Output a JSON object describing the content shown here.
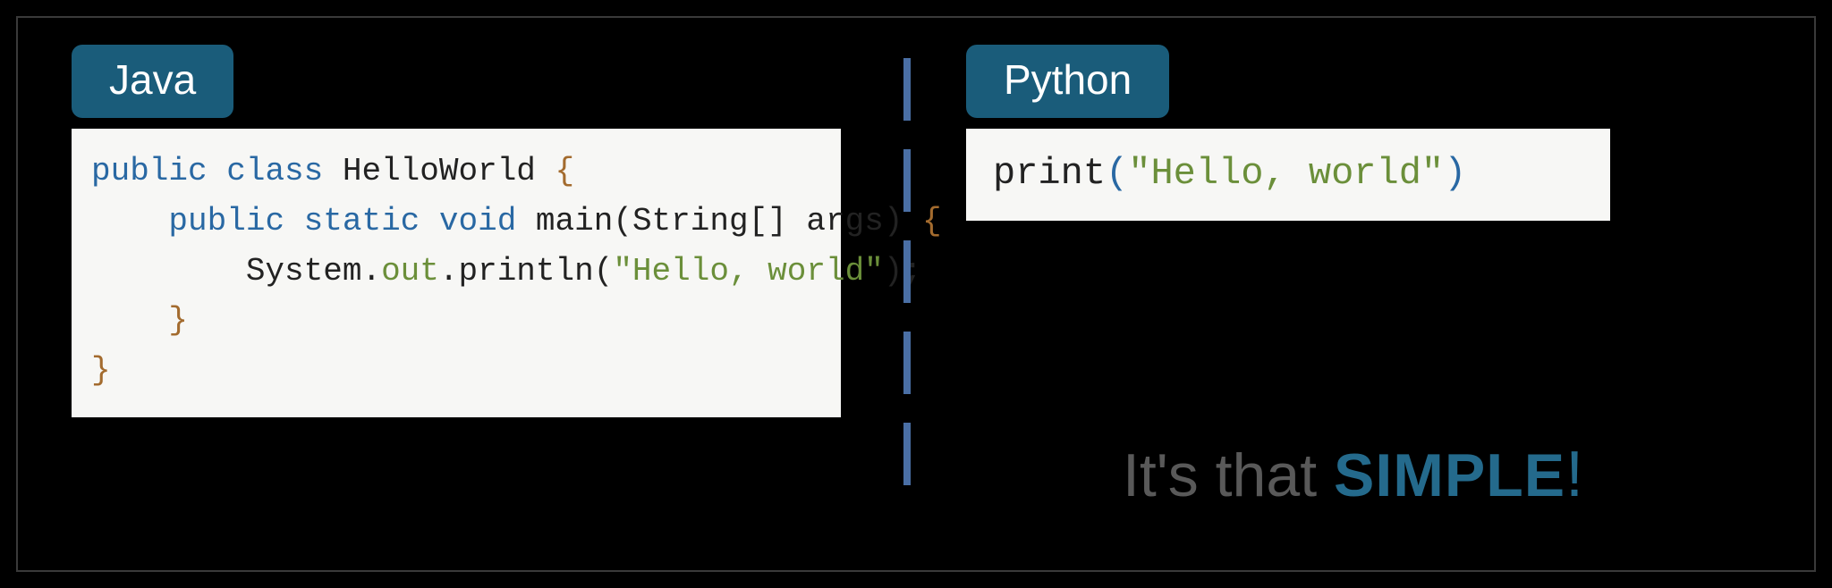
{
  "left": {
    "badge": "Java",
    "code": {
      "l1_kw1": "public",
      "l1_kw2": "class",
      "l1_id": "HelloWorld",
      "l2_kw1": "public",
      "l2_kw2": "static",
      "l2_kw3": "void",
      "l2_id1": "main",
      "l2_id2": "String",
      "l2_id3": "args",
      "l3_a": "System",
      "l3_b": "out",
      "l3_c": "println",
      "l3_str": "\"Hello, world\""
    }
  },
  "right": {
    "badge": "Python",
    "code": {
      "fn": "print",
      "str": "\"Hello, world\""
    }
  },
  "tagline": {
    "prefix": "It's that ",
    "accent": "SIMPLE",
    "excl": "!"
  }
}
